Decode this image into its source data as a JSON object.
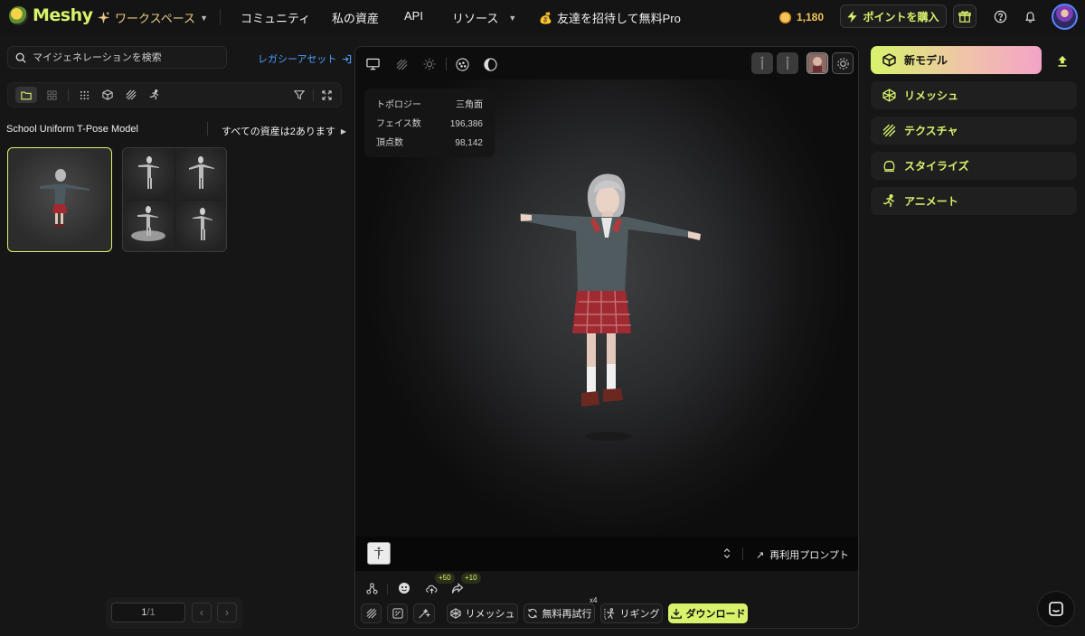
{
  "brand": {
    "name": "Meshy"
  },
  "nav": {
    "workspace": "ワークスペース",
    "community": "コミュニティ",
    "my_assets": "私の資産",
    "api": "API",
    "resources": "リソース",
    "invite": "友達を招待して無料Pro",
    "points": "1,180",
    "buy_points": "ポイントを購入"
  },
  "left": {
    "search_placeholder": "マイジェネレーションを検索",
    "legacy_assets": "レガシーアセット",
    "asset_title": "School Uniform T-Pose Model",
    "asset_count": "すべての資産は2あります",
    "pager": {
      "page": "1",
      "total": "/1"
    }
  },
  "viewport": {
    "stats": [
      {
        "label": "トポロジー",
        "value": "三角面"
      },
      {
        "label": "フェイス数",
        "value": "196,386"
      },
      {
        "label": "頂点数",
        "value": "98,142"
      }
    ],
    "reuse_prompt": "再利用プロンプト",
    "badges": {
      "upload": "+50",
      "share": "+10"
    },
    "actions": {
      "remesh": "リメッシュ",
      "free_retry": "無料再試行",
      "retry_count": "x4",
      "rigging": "リギング",
      "download": "ダウンロード"
    }
  },
  "right": {
    "new_model": "新モデル",
    "remesh": "リメッシュ",
    "texture": "テクスチャ",
    "stylize": "スタイライズ",
    "animate": "アニメート"
  },
  "colors": {
    "accent": "#d8f36b",
    "link": "#4d9fff",
    "coin": "#f3c75a"
  }
}
